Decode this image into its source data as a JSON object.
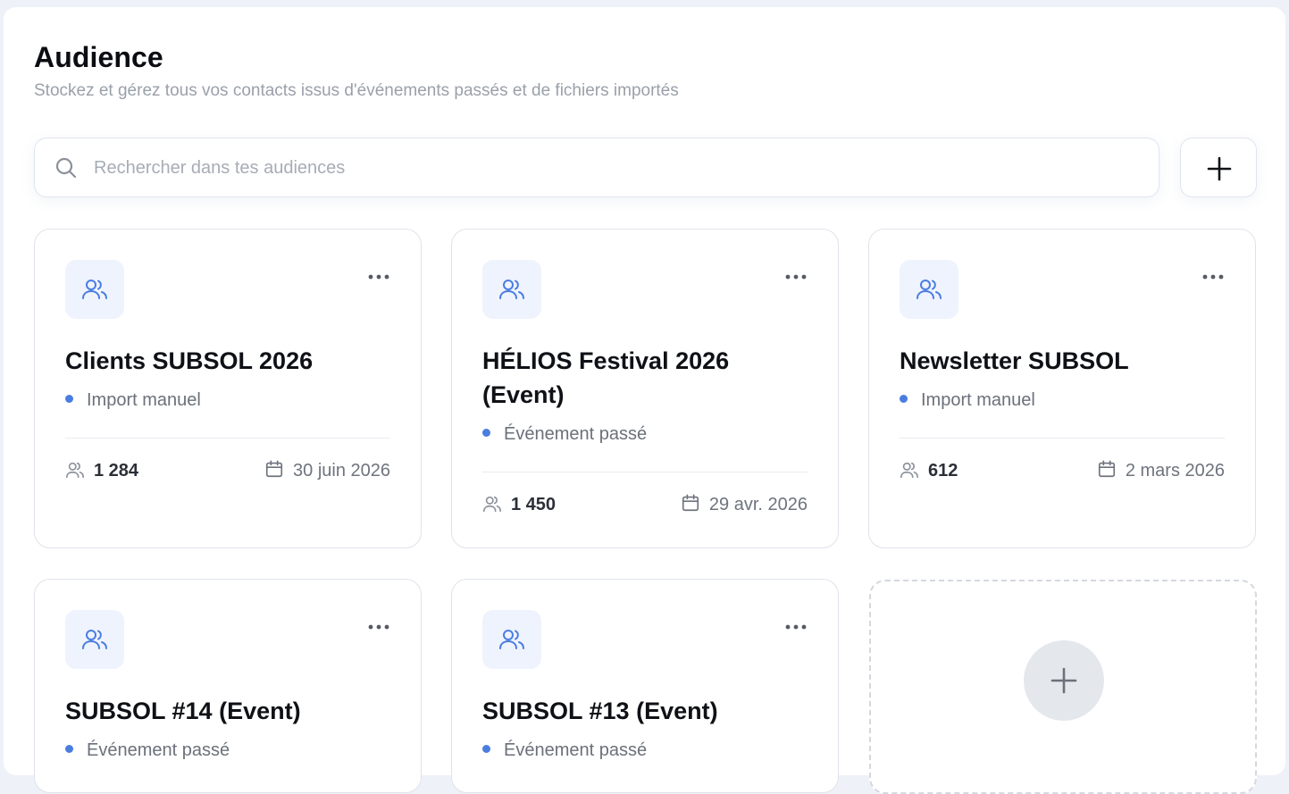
{
  "header": {
    "title": "Audience",
    "subtitle": "Stockez et gérez tous vos contacts issus d'événements passés et de fichiers importés"
  },
  "search": {
    "placeholder": "Rechercher dans tes audiences",
    "value": ""
  },
  "colors": {
    "accent": "#4a7de0",
    "icon_bg": "#eef3fd",
    "muted_text": "#9aa0aa"
  },
  "icons": {
    "search": "search-icon",
    "add": "plus-icon",
    "audience": "users-icon",
    "menu": "more-horizontal-icon",
    "count": "users-icon",
    "date": "calendar-icon"
  },
  "cards": [
    {
      "title": "Clients SUBSOL 2026",
      "type": "Import manuel",
      "count": "1 284",
      "date": "30 juin 2026"
    },
    {
      "title": "HÉLIOS Festival 2026 (Event)",
      "type": "Événement passé",
      "count": "1 450",
      "date": "29 avr. 2026"
    },
    {
      "title": "Newsletter SUBSOL",
      "type": "Import manuel",
      "count": "612",
      "date": "2 mars 2026"
    },
    {
      "title": "SUBSOL #14 (Event)",
      "type": "Événement passé"
    },
    {
      "title": "SUBSOL #13 (Event)",
      "type": "Événement passé"
    }
  ]
}
